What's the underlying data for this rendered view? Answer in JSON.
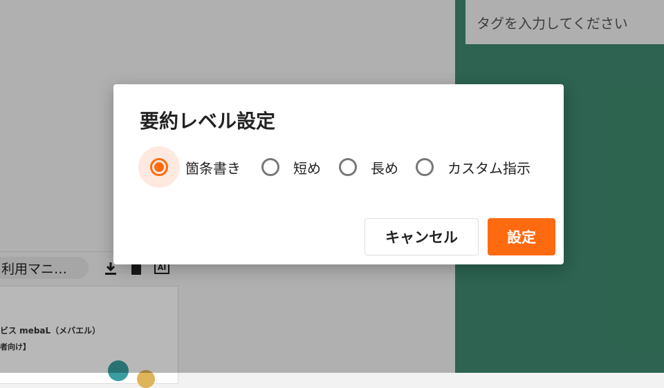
{
  "background": {
    "tag_input": {
      "placeholder": "タグを入力してください"
    },
    "doc_tab_title": "利用マニ…",
    "icons": {
      "download": "download-icon",
      "clipboard": "clipboard-icon",
      "ai": "AI"
    },
    "doc_preview": {
      "line1": "ビス mebaL（メバエル）",
      "line2": "者向け】"
    },
    "colors": {
      "panel_green": "#3f8a6f"
    }
  },
  "dialog": {
    "title": "要約レベル設定",
    "options": [
      {
        "label": "箇条書き",
        "selected": true
      },
      {
        "label": "短め",
        "selected": false
      },
      {
        "label": "長め",
        "selected": false
      },
      {
        "label": "カスタム指示",
        "selected": false
      }
    ],
    "cancel_label": "キャンセル",
    "ok_label": "設定",
    "colors": {
      "accent": "#fe6a10"
    }
  }
}
